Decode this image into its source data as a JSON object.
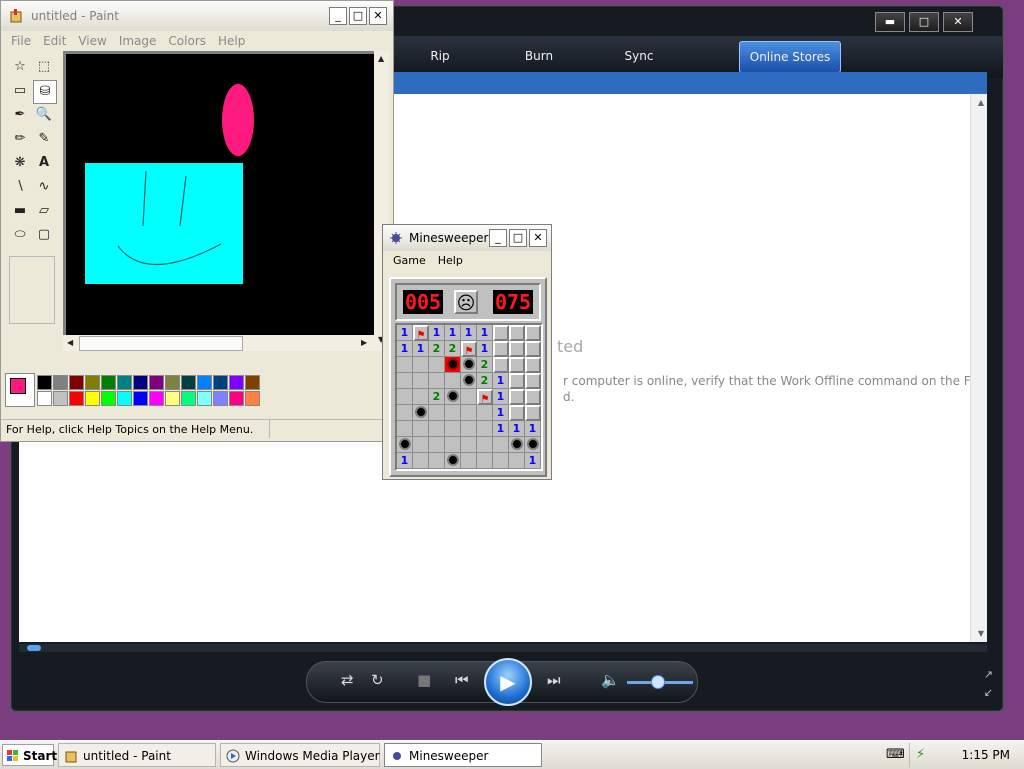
{
  "wmp": {
    "tabs": [
      "Rip",
      "Burn",
      "Sync",
      "Online Stores"
    ],
    "content": {
      "title_fragment": "ted",
      "message_line1": "r computer is online, verify that the Work Offline command on the File",
      "message_line2": "d."
    }
  },
  "paint": {
    "title": "untitled - Paint",
    "menu": [
      "File",
      "Edit",
      "View",
      "Image",
      "Colors",
      "Help"
    ],
    "status": "For Help, click Help Topics on the Help Menu.",
    "palette_row1": [
      "#000000",
      "#808080",
      "#800000",
      "#808000",
      "#008000",
      "#008080",
      "#000080",
      "#800080",
      "#808040",
      "#004040",
      "#0080ff",
      "#004080",
      "#8000ff",
      "#804000"
    ],
    "palette_row2": [
      "#ffffff",
      "#c0c0c0",
      "#ff0000",
      "#ffff00",
      "#00ff00",
      "#00ffff",
      "#0000ff",
      "#ff00ff",
      "#ffff80",
      "#00ff80",
      "#80ffff",
      "#8080ff",
      "#ff0080",
      "#ff8040"
    ],
    "foreground_color": "#ff1a7f",
    "canvas_colors": {
      "background": "#000000",
      "oval": "#ff1a7f",
      "rectangle": "#00ffff"
    }
  },
  "minesweeper": {
    "title": "Minesweeper",
    "menu": [
      "Game",
      "Help"
    ],
    "mines_left": "005",
    "timer": "075",
    "face": "☹",
    "grid": [
      [
        "1",
        "F",
        "1",
        "1",
        "1",
        "1",
        "",
        "",
        ""
      ],
      [
        "1",
        "1",
        "2",
        "2",
        "F",
        "1",
        "",
        "",
        ""
      ],
      [
        " ",
        " ",
        " ",
        "X",
        "M",
        "2",
        "",
        "",
        ""
      ],
      [
        " ",
        " ",
        " ",
        " ",
        "M",
        "2",
        "1",
        "",
        ""
      ],
      [
        " ",
        " ",
        "2",
        "M",
        " ",
        "F",
        "1",
        "",
        ""
      ],
      [
        " ",
        "M",
        " ",
        " ",
        " ",
        " ",
        "1",
        "",
        ""
      ],
      [
        " ",
        " ",
        " ",
        " ",
        " ",
        " ",
        "1",
        "1",
        "1"
      ],
      [
        "M",
        " ",
        " ",
        " ",
        " ",
        " ",
        " ",
        "M",
        "M"
      ],
      [
        "1",
        " ",
        " ",
        "M",
        " ",
        " ",
        " ",
        " ",
        "1"
      ]
    ]
  },
  "taskbar": {
    "start_label": "Start",
    "tasks": [
      "untitled - Paint",
      "Windows Media Player",
      "Minesweeper"
    ],
    "clock": "1:15 PM"
  }
}
